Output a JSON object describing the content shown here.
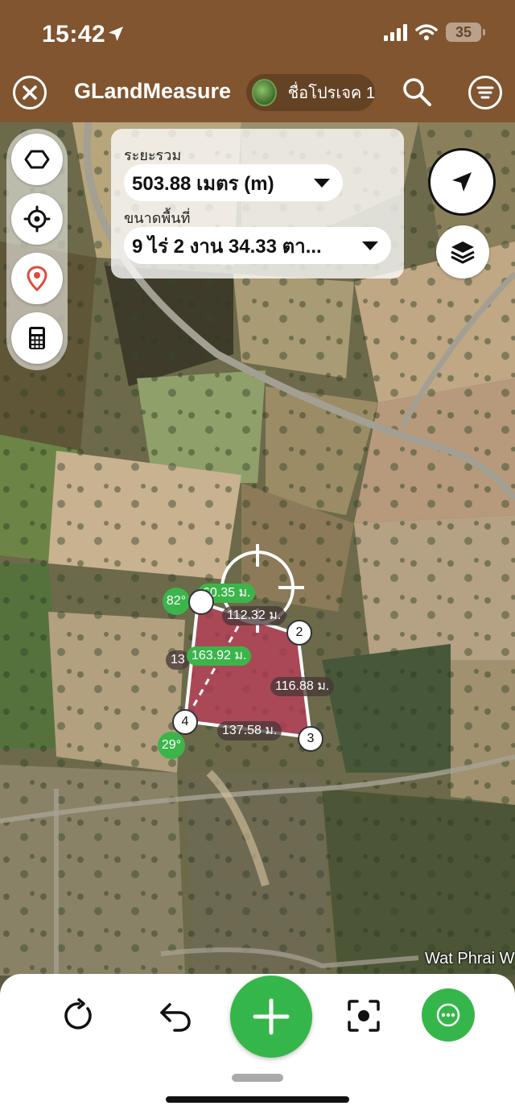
{
  "status_bar": {
    "time": "15:42",
    "battery": "35"
  },
  "header": {
    "app_title": "GLandMeasure",
    "project_name": "ชื่อโปรเจค 1"
  },
  "measure": {
    "total_label": "ระยะรวม",
    "total_value": "503.88 เมตร (m)",
    "area_label": "ขนาดพื้นที่",
    "area_value": "9 ไร่ 2 งาน 34.33 ตา..."
  },
  "edges": {
    "top": "112.32 ม.",
    "right": "116.88 ม.",
    "bottom": "137.58 ม.",
    "left_partial": "13",
    "green_top": "60.35 ม.",
    "green_diag": "163.92 ม."
  },
  "angles": {
    "a1": "82°",
    "a4": "29°"
  },
  "vertices": {
    "v2": "2",
    "v3": "3",
    "v4": "4"
  },
  "map": {
    "place_label": "Wat Phrai W"
  },
  "colors": {
    "header": "#80552f",
    "accent_green": "#35b64a",
    "plot_fill": "#d0335f"
  },
  "icons": {
    "left_tools": [
      "polygon-icon",
      "crosshair-icon",
      "location-pin-icon",
      "calculator-icon"
    ],
    "right_tools": [
      "navigation-arrow-icon",
      "layers-icon"
    ],
    "bottom": [
      "refresh-icon",
      "undo-icon",
      "plus-icon",
      "focus-icon",
      "more-icon"
    ]
  }
}
